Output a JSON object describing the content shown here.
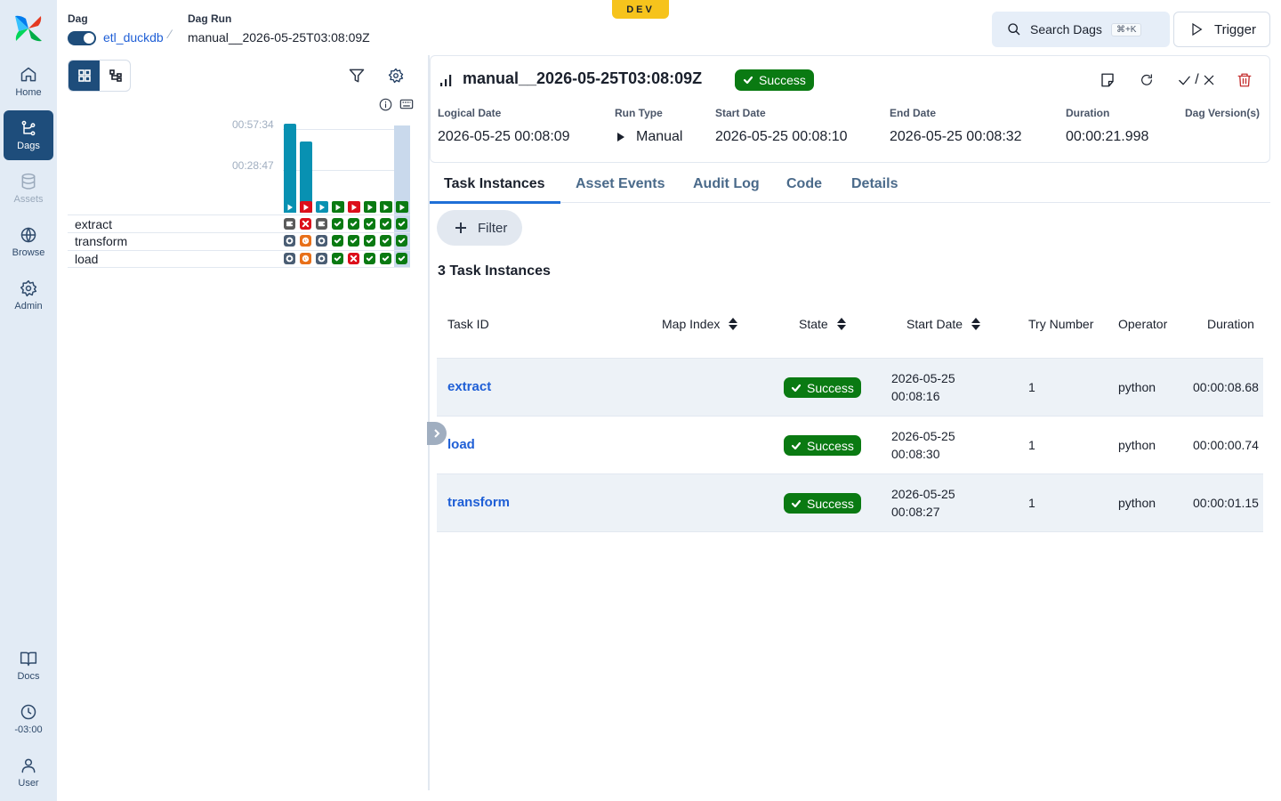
{
  "env_badge": "DEV",
  "nav": {
    "items": [
      {
        "label": "Home"
      },
      {
        "label": "Dags"
      },
      {
        "label": "Assets"
      },
      {
        "label": "Browse"
      },
      {
        "label": "Admin"
      },
      {
        "label": "Docs"
      },
      {
        "label": "-03:00"
      },
      {
        "label": "User"
      }
    ]
  },
  "breadcrumb": {
    "dag_label": "Dag",
    "dag_name": "etl_duckdb",
    "run_label": "Dag Run",
    "run_name": "manual__2026-05-25T03:08:09Z"
  },
  "header": {
    "search_label": "Search Dags",
    "search_shortcut": "⌘+K",
    "trigger_label": "Trigger"
  },
  "grid": {
    "duration_ticks": [
      "00:57:34",
      "00:28:47"
    ],
    "run_states": [
      "running",
      "failed",
      "running",
      "success",
      "failed",
      "success",
      "success",
      "success"
    ],
    "run_duration_fractions": [
      1.0,
      0.8,
      0,
      0,
      0,
      0,
      0,
      0
    ],
    "tasks": [
      {
        "name": "extract",
        "states": [
          "queued",
          "failed",
          "queued",
          "success",
          "success",
          "success",
          "success",
          "success"
        ]
      },
      {
        "name": "transform",
        "states": [
          "scheduled",
          "up_for_retry",
          "scheduled",
          "success",
          "success",
          "success",
          "success",
          "success"
        ]
      },
      {
        "name": "load",
        "states": [
          "scheduled",
          "up_for_retry",
          "scheduled",
          "success",
          "failed",
          "success",
          "success",
          "success"
        ]
      }
    ],
    "state_colors": {
      "success": "#0a7a12",
      "failed": "#dc0e1a",
      "running": "#0891b2",
      "queued": "#5a5a5a",
      "scheduled": "#4a5d73",
      "up_for_retry": "#e8701a"
    }
  },
  "run": {
    "title": "manual__2026-05-25T03:08:09Z",
    "status": "Success",
    "meta": [
      {
        "label": "Logical Date",
        "value": "2026-05-25 00:08:09"
      },
      {
        "label": "Run Type",
        "value": "Manual"
      },
      {
        "label": "Start Date",
        "value": "2026-05-25 00:08:10"
      },
      {
        "label": "End Date",
        "value": "2026-05-25 00:08:32"
      },
      {
        "label": "Duration",
        "value": "00:00:21.998"
      },
      {
        "label": "Dag Version(s)",
        "value": ""
      }
    ],
    "mark_separator": "/"
  },
  "tabs": [
    "Task Instances",
    "Asset Events",
    "Audit Log",
    "Code",
    "Details"
  ],
  "filter_label": "Filter",
  "task_count_heading": "3 Task Instances",
  "table": {
    "columns": [
      "Task ID",
      "Map Index",
      "State",
      "Start Date",
      "Try Number",
      "Operator",
      "Duration"
    ],
    "rows": [
      {
        "task_id": "extract",
        "state": "Success",
        "start_date_line1": "2026-05-25",
        "start_date_line2": "00:08:16",
        "try_number": "1",
        "operator": "python",
        "duration": "00:00:08.68"
      },
      {
        "task_id": "load",
        "state": "Success",
        "start_date_line1": "2026-05-25",
        "start_date_line2": "00:08:30",
        "try_number": "1",
        "operator": "python",
        "duration": "00:00:00.74"
      },
      {
        "task_id": "transform",
        "state": "Success",
        "start_date_line1": "2026-05-25",
        "start_date_line2": "00:08:27",
        "try_number": "1",
        "operator": "python",
        "duration": "00:00:01.15"
      }
    ]
  },
  "colors": {
    "accent": "#1e4d7b",
    "link": "#1f5fd6",
    "success": "#0a7a12",
    "dev_badge": "#f6c31c"
  }
}
